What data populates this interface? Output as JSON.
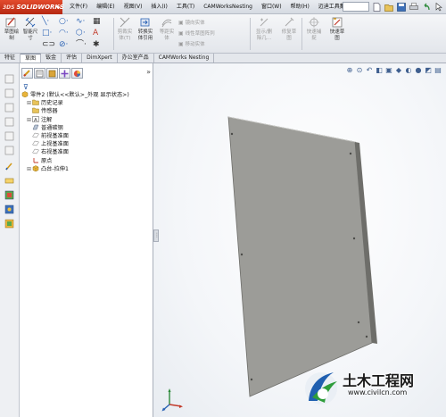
{
  "app": {
    "logo_text": "SOLIDWORKS",
    "logo_prefix": "3DS"
  },
  "menu": [
    "文件(F)",
    "编辑(E)",
    "视图(V)",
    "插入(I)",
    "工具(T)",
    "CAMWorksNesting",
    "窗口(W)",
    "帮助(H)",
    "迈迪工具集"
  ],
  "commands": {
    "sketch": "草图绘\n制",
    "smart_dim": "智能尺\n寸",
    "trim": "剪裁实\n体(T)",
    "convert": "转换实\n体引用",
    "offset": "等距实\n体",
    "mirror": "镜向实体",
    "linear_pattern": "线性草图阵列",
    "move": "移动实体",
    "show_relations": "显示/删\n除几...",
    "repair": "修复草\n图",
    "quick_snap": "快速捕\n捉",
    "rapid_sketch": "快速草\n图"
  },
  "tabs": [
    "特征",
    "草图",
    "钣金",
    "评估",
    "DimXpert",
    "办公室产品",
    "CAMWorks Nesting"
  ],
  "tree": {
    "root": "零件2 (默认<<默认>_外观 显示状态>)",
    "items": [
      "历史记录",
      "传感器",
      "注解",
      "普通碳钢",
      "前视基准面",
      "上视基准面",
      "右视基准面",
      "原点",
      "凸台-拉伸1"
    ]
  },
  "watermark": {
    "title": "土木工程网",
    "url": "www.civilcn.com"
  },
  "colors": {
    "logo_red": "#cc3a1f",
    "panel_gray": "#9c9c98",
    "panel_edge": "#6e6e6a",
    "accent_blue": "#2d5fa8"
  }
}
